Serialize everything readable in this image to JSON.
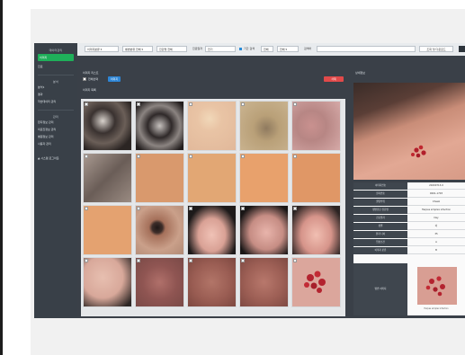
{
  "sidebar": {
    "section1": "데이터관리",
    "items1": [
      {
        "label": "이미지",
        "active": true
      },
      {
        "label": "진료"
      }
    ],
    "section2": "분석",
    "items2": [
      "분석1",
      "결과",
      "학습데이터 관리"
    ],
    "section3": "관리",
    "items3": [
      "환자정보 관리",
      "의료진정보 관리",
      "병원정보 관리",
      "사용자 관리"
    ],
    "logout": "시스템 로그아웃"
  },
  "topbar": {
    "select1": "이미지분류",
    "select2": "병변분류 전체",
    "select3": "진단명 전체",
    "label_date": "진료일자",
    "date_value": "전기",
    "check_label": "기간 검색",
    "select4": "전체",
    "select5": "전체",
    "label_search": "검색어",
    "search_button": "조회 및 다운로드"
  },
  "grid": {
    "title": "이미지 리스트",
    "select_all": "전체선택",
    "action_button": "이미지",
    "delete_button": "삭제",
    "subtitle": "이미지 목록"
  },
  "detail": {
    "title": "상세정보",
    "rows": [
      {
        "key": "이미지번호",
        "value": "20200713-0"
      },
      {
        "key": "환자번호",
        "value": "0001-1703"
      },
      {
        "key": "촬영부위",
        "value": "Cheek"
      },
      {
        "key": "병변진단 진단명",
        "value": "Herpes simplex infection"
      },
      {
        "key": "진료일자",
        "value": "Day"
      },
      {
        "key": "성별",
        "value": "여"
      },
      {
        "key": "환자 나이",
        "value": "35"
      },
      {
        "key": "임상소견",
        "value": "A"
      },
      {
        "key": "이미지 분류",
        "value": "B"
      }
    ],
    "thumb_label": "병변 이미지",
    "thumb_caption": "Herpes simplex infection"
  },
  "colors": {
    "sidebar_bg": "#394048",
    "active_green": "#1fb05a",
    "button_blue": "#2e86d6",
    "delete_red": "#e14a4a"
  }
}
